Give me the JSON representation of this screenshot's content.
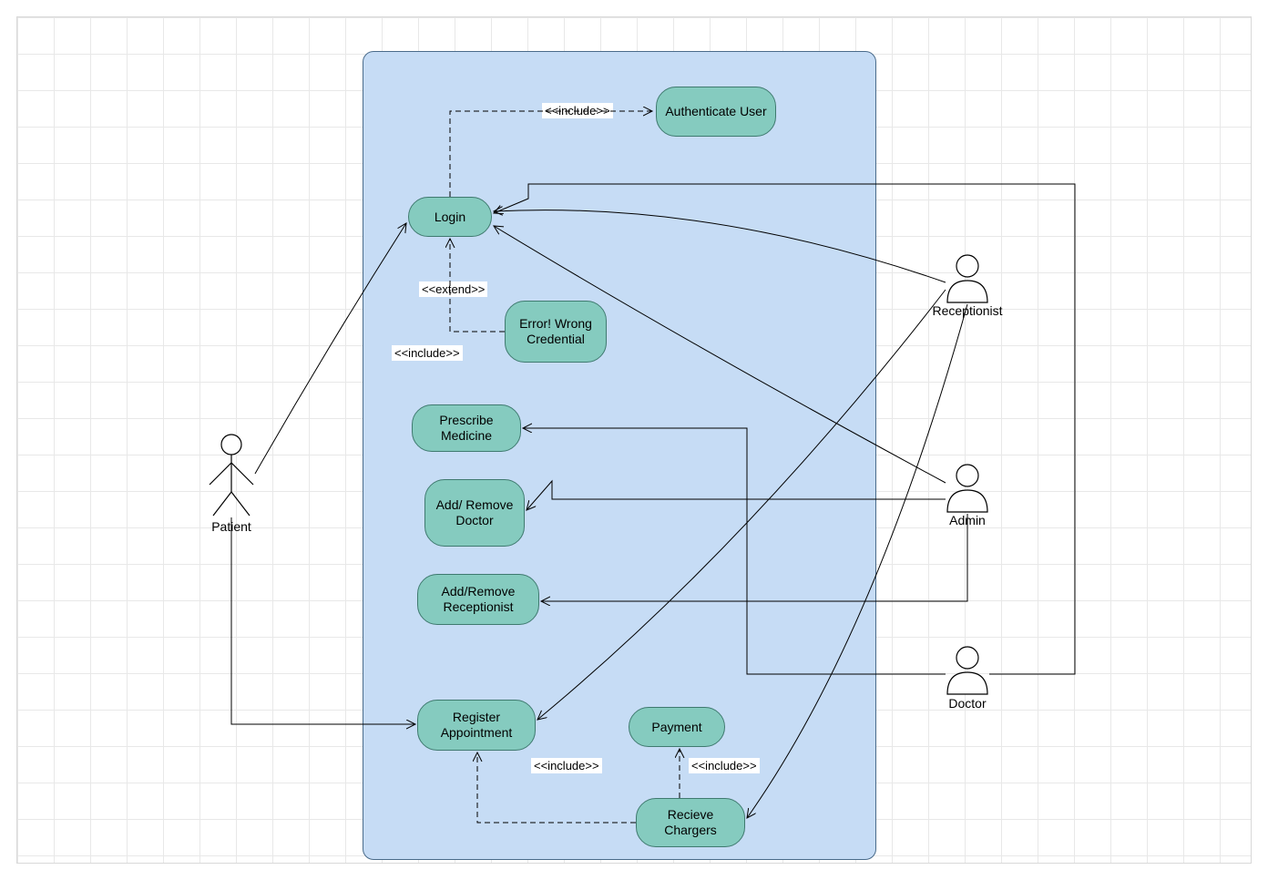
{
  "actors": {
    "patient": "Patient",
    "receptionist": "Receptionist",
    "admin": "Admin",
    "doctor": "Doctor"
  },
  "usecases": {
    "login": "Login",
    "authenticate": "Authenticate User",
    "error": "Error! Wrong Credential",
    "prescribe": "Prescribe Medicine",
    "addDoctor": "Add/ Remove Doctor",
    "addReceptionist": "Add/Remove Receptionist",
    "registerAppt": "Register Appointment",
    "payment": "Payment",
    "receive": "Recieve Chargers"
  },
  "stereo": {
    "include": "<<include>>",
    "extend": "<<extend>>"
  }
}
